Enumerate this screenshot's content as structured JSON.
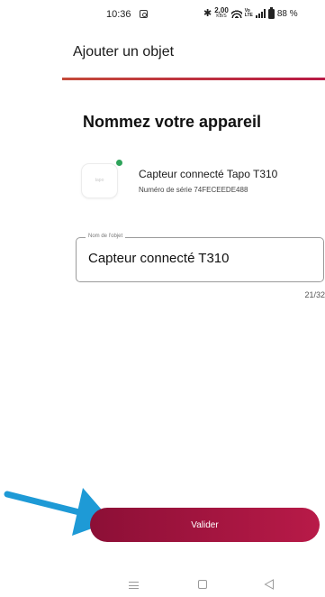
{
  "status_bar": {
    "time": "10:36",
    "net_speed_value": "2,00",
    "net_speed_unit": "KB/S",
    "lte_top": "Vo",
    "lte_bottom": "LTE",
    "battery": "88 %"
  },
  "header": {
    "title": "Ajouter un objet"
  },
  "main": {
    "heading": "Nommez votre appareil",
    "device": {
      "thumb_label": "tapo",
      "name": "Capteur connecté Tapo T310",
      "serial": "Numéro de série 74FECEEDE488"
    },
    "name_field": {
      "label": "Nom de l'objet",
      "value": "Capteur connecté T310",
      "counter": "21/32"
    },
    "validate_label": "Valider"
  },
  "icons": {
    "camera": "camera-icon",
    "bluetooth": "bluetooth-icon",
    "wifi": "wifi-icon",
    "signal": "signal-icon",
    "battery": "battery-icon",
    "arrow": "arrow-icon",
    "menu": "menu-icon",
    "home": "home-icon",
    "back": "back-icon"
  },
  "colors": {
    "accent_start": "#8c0f36",
    "accent_end": "#b81a48",
    "divider_start": "#c44a3a",
    "online_dot": "#2ea35a",
    "arrow": "#1e9ad6"
  }
}
